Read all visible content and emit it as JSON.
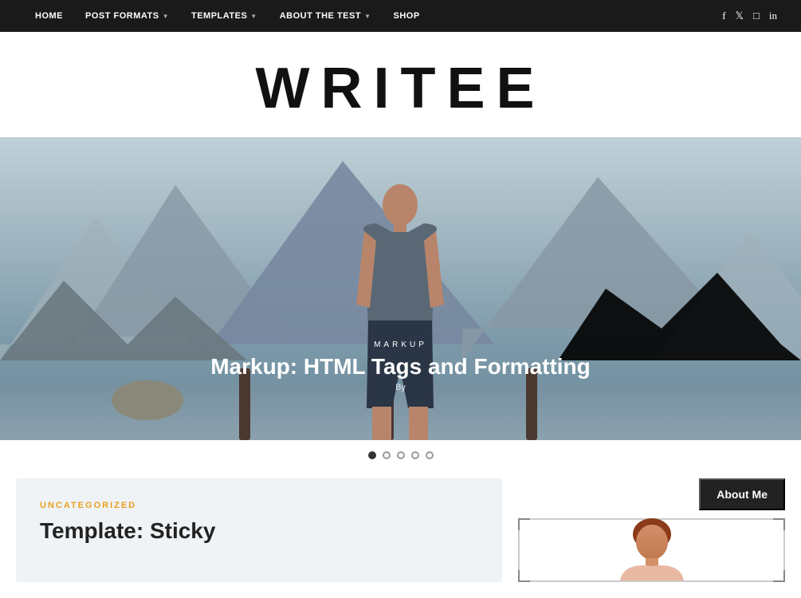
{
  "nav": {
    "links": [
      {
        "label": "HOME",
        "has_dropdown": false
      },
      {
        "label": "POST FORMATS",
        "has_dropdown": true
      },
      {
        "label": "TEMPLATES",
        "has_dropdown": true
      },
      {
        "label": "ABOUT THE TEST",
        "has_dropdown": true
      },
      {
        "label": "SHOP",
        "has_dropdown": false
      }
    ],
    "social_icons": [
      "facebook",
      "twitter",
      "instagram",
      "linkedin"
    ]
  },
  "header": {
    "title": "WRITEE"
  },
  "hero": {
    "category": "MARKUP",
    "title": "Markup: HTML Tags and Formatting",
    "by_label": "By"
  },
  "slider": {
    "dots": [
      {
        "active": true
      },
      {
        "active": false
      },
      {
        "active": false
      },
      {
        "active": false
      },
      {
        "active": false
      }
    ]
  },
  "article": {
    "category": "UNCATEGORIZED",
    "title": "Template: Sticky"
  },
  "sidebar": {
    "about_me_label": "About Me"
  }
}
